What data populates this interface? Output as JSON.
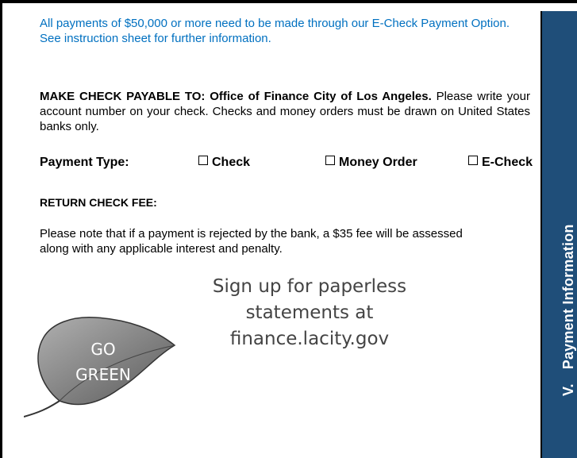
{
  "e_check_note": "All payments of $50,000 or more need to be made through our E-Check Payment Option. See instruction sheet for further information.",
  "payable": {
    "heading": "MAKE CHECK PAYABLE TO: Office of Finance City of Los Angeles.",
    "body": "Please write your account number on your check.  Checks and money orders must be drawn on United States banks only."
  },
  "payment_type": {
    "label": "Payment Type:",
    "options": [
      "Check",
      "Money Order",
      "E-Check"
    ]
  },
  "return_check": {
    "heading": "RETURN CHECK FEE:",
    "body": "Please note that if a payment is rejected by the bank, a $35 fee will be assessed along with any applicable interest and penalty."
  },
  "go_green": {
    "leaf_line1": "GO",
    "leaf_line2": "GREEN",
    "signup_line1": "Sign up for paperless",
    "signup_line2": "statements at",
    "signup_line3": "finance.lacity.gov"
  },
  "sidebar": {
    "number": "V.",
    "title": "Payment Information"
  },
  "colors": {
    "accent_text": "#0070c0",
    "sidebar_bg": "#1f4e79"
  }
}
